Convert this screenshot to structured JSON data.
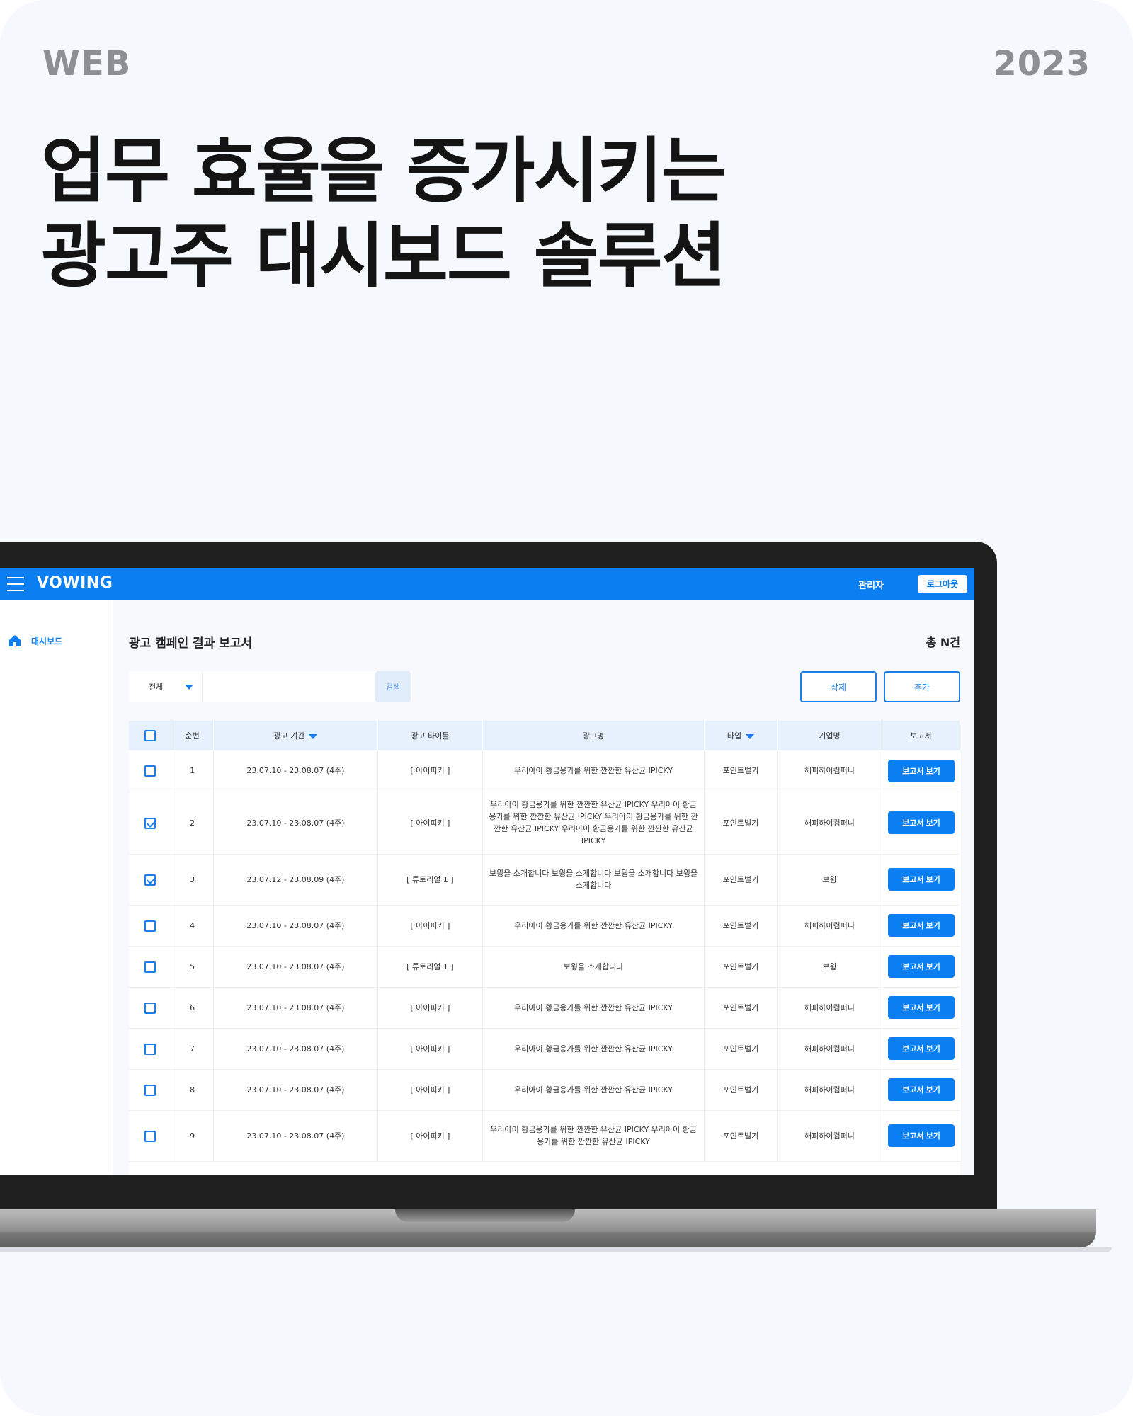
{
  "header": {
    "web_label": "WEB",
    "year_label": "2023"
  },
  "headline": {
    "line1": "업무 효율을 증가시키는",
    "line2": "광고주 대시보드 솔루션"
  },
  "app": {
    "brand": "VOWING",
    "admin_label": "관리자",
    "logout_label": "로그아웃",
    "sidebar": {
      "items": [
        {
          "label": "대시보드",
          "icon": "home-icon"
        }
      ]
    },
    "page_title": "광고 캠페인 결과 보고서",
    "total_label": "총 N건",
    "filter": {
      "select_value": "전체",
      "search_placeholder": "",
      "search_label": "검색"
    },
    "actions": {
      "delete_label": "삭제",
      "add_label": "추가"
    },
    "table": {
      "headers": [
        "순번",
        "광고 기간",
        "광고 타이틀",
        "광고명",
        "타입",
        "기업명",
        "보고서"
      ],
      "report_button_label": "보고서 보기",
      "rows": [
        {
          "checked": false,
          "no": "1",
          "period": "23.07.10 - 23.08.07 (4주)",
          "title": "[ 아이피키 ]",
          "name": "우리아이 황금응가를 위한 깐깐한 유산균 IPICKY",
          "type": "포인트벌기",
          "company": "해피하이컴퍼니"
        },
        {
          "checked": true,
          "no": "2",
          "period": "23.07.10 - 23.08.07 (4주)",
          "title": "[ 아이피키 ]",
          "name": "우리아이 황금응가를 위한 깐깐한 유산균 IPICKY 우리아이 황금응가를 위한 깐깐한 유산균 IPICKY  우리아이 황금응가를 위한 깐깐한 유산균 IPICKY 우리아이 황금응가를 위한 깐깐한 유산균 IPICKY",
          "type": "포인트벌기",
          "company": "해피하이컴퍼니"
        },
        {
          "checked": true,
          "no": "3",
          "period": "23.07.12 - 23.08.09 (4주)",
          "title": "[ 튜토리얼 1 ]",
          "name": "보윙을 소개합니다 보윙을 소개합니다 보윙을 소개합니다 보윙을 소개합니다",
          "type": "포인트벌기",
          "company": "보윙"
        },
        {
          "checked": false,
          "no": "4",
          "period": "23.07.10 - 23.08.07 (4주)",
          "title": "[ 아이피키 ]",
          "name": "우리아이 황금응가를 위한 깐깐한 유산균 IPICKY",
          "type": "포인트벌기",
          "company": "해피하이컴퍼니"
        },
        {
          "checked": false,
          "no": "5",
          "period": "23.07.10 - 23.08.07 (4주)",
          "title": "[ 튜토리얼 1 ]",
          "name": "보윙을 소개합니다",
          "type": "포인트벌기",
          "company": "보윙"
        },
        {
          "checked": false,
          "no": "6",
          "period": "23.07.10 - 23.08.07 (4주)",
          "title": "[ 아이피키 ]",
          "name": "우리아이 황금응가를 위한 깐깐한 유산균 IPICKY",
          "type": "포인트벌기",
          "company": "해피하이컴퍼니"
        },
        {
          "checked": false,
          "no": "7",
          "period": "23.07.10 - 23.08.07 (4주)",
          "title": "[ 아이피키 ]",
          "name": "우리아이 황금응가를 위한 깐깐한 유산균 IPICKY",
          "type": "포인트벌기",
          "company": "해피하이컴퍼니"
        },
        {
          "checked": false,
          "no": "8",
          "period": "23.07.10 - 23.08.07 (4주)",
          "title": "[ 아이피키 ]",
          "name": "우리아이 황금응가를 위한 깐깐한 유산균 IPICKY",
          "type": "포인트벌기",
          "company": "해피하이컴퍼니"
        },
        {
          "checked": false,
          "no": "9",
          "period": "23.07.10 - 23.08.07 (4주)",
          "title": "[ 아이피키 ]",
          "name": "우리아이 황금응가를 위한 깐깐한 유산균 IPICKY 우리아이 황금응가를 위한 깐깐한 유산균 IPICKY",
          "type": "포인트벌기",
          "company": "해피하이컴퍼니"
        }
      ]
    }
  },
  "colors": {
    "accent": "#0b7ff2",
    "background": "#f5f8fd",
    "header_row": "#e6f1fd"
  }
}
